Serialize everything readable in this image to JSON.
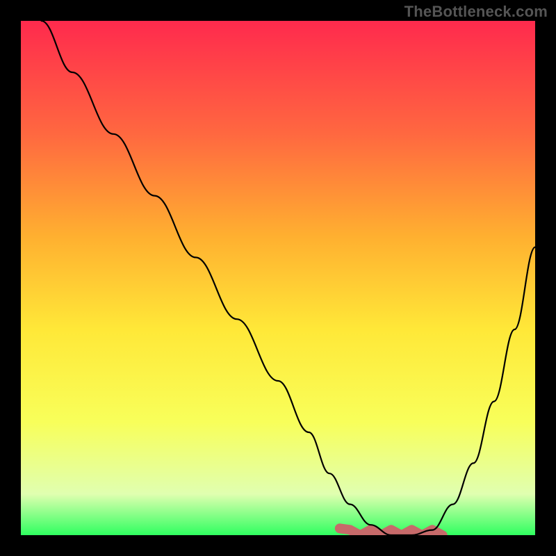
{
  "watermark": "TheBottleneck.com",
  "colors": {
    "black": "#000000",
    "curve": "#000000",
    "marker": "#c76a6a",
    "grad_top": "#ff2a4d",
    "grad_mid1": "#ff6840",
    "grad_mid2": "#ffb030",
    "grad_mid3": "#ffe838",
    "grad_mid4": "#f8ff5a",
    "grad_mid5": "#e0ffb0",
    "grad_bot": "#2fff60"
  },
  "chart_data": {
    "type": "line",
    "title": "",
    "xlabel": "",
    "ylabel": "",
    "xlim": [
      0,
      100
    ],
    "ylim": [
      0,
      100
    ],
    "x": [
      4,
      10,
      18,
      26,
      34,
      42,
      50,
      56,
      60,
      64,
      68,
      72,
      76,
      80,
      84,
      88,
      92,
      96,
      100
    ],
    "values": [
      100,
      90,
      78,
      66,
      54,
      42,
      30,
      20,
      12,
      6,
      2,
      0,
      0,
      1,
      6,
      14,
      26,
      40,
      56
    ],
    "marker_region": {
      "x_start": 62,
      "x_end": 82,
      "y": 0.5
    }
  }
}
